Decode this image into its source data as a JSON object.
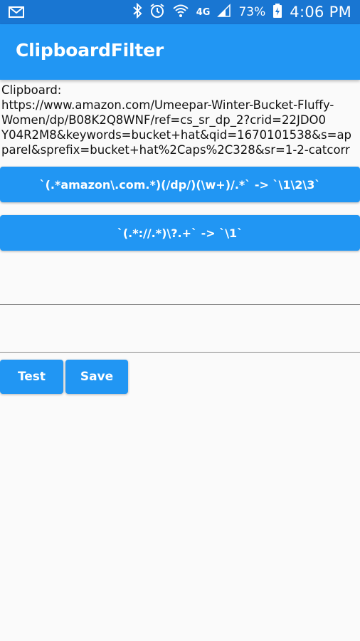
{
  "status_bar": {
    "mail_icon": "mail-icon",
    "bluetooth_icon": "bluetooth-icon",
    "alarm_icon": "alarm-icon",
    "wifi_icon": "wifi-icon",
    "network": "4G",
    "signal_icon": "signal-icon",
    "battery": "73%",
    "battery_icon": "battery-charging-icon",
    "time": "4:06 PM"
  },
  "app_bar": {
    "title": "ClipboardFilter"
  },
  "clipboard": {
    "lines": [
      "Clipboard:",
      "https://www.amazon.com/Umeepar-Winter-Bucket-Fluffy-",
      "Women/dp/B08K2Q8WNF/ref=cs_sr_dp_2?crid=22JDO0",
      "Y04R2M8&keywords=bucket+hat&qid=1670101538&s=ap",
      "parel&sprefix=bucket+hat%2Caps%2C328&sr=1-2-catcorr"
    ]
  },
  "rules": [
    {
      "label": "`(.*amazon\\.com.*)(/dp/)(\\w+)/.*` -> `\\1\\2\\3`"
    },
    {
      "label": "`(.*://.*)\\?.+` -> `\\1`"
    }
  ],
  "fields": {
    "pattern": {
      "value": "",
      "placeholder": ""
    },
    "replacement": {
      "value": "",
      "placeholder": ""
    }
  },
  "actions": {
    "test_label": "Test",
    "save_label": "Save"
  },
  "colors": {
    "primary": "#2196f3",
    "status_bar": "#1976d2",
    "background": "#fafafa"
  }
}
